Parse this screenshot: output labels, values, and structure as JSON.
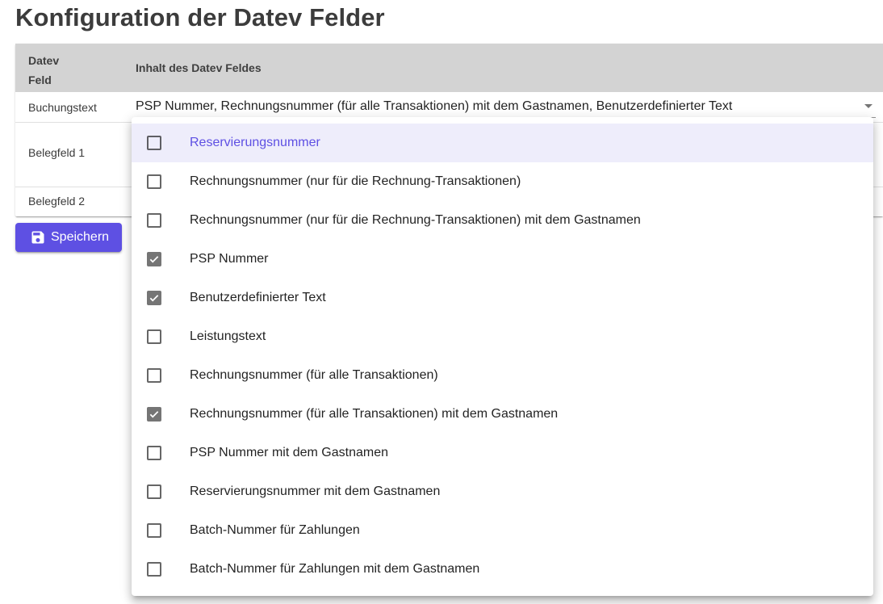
{
  "page": {
    "title": "Konfiguration der Datev Felder"
  },
  "table": {
    "header": {
      "feld": "Datev Feld",
      "inhalt": "Inhalt des Datev Feldes"
    },
    "rows": [
      {
        "feld": "Buchungstext",
        "inhalt": "PSP Nummer, Rechnungsnummer (für alle Transaktionen) mit dem Gastnamen, Benutzerdefinierter Text"
      },
      {
        "feld": "Belegfeld 1",
        "inhalt": ""
      },
      {
        "feld": "Belegfeld 2",
        "inhalt": ""
      }
    ]
  },
  "save_button": {
    "label": "Speichern",
    "icon": "save-icon"
  },
  "menu": {
    "items": [
      {
        "label": "Reservierungsnummer",
        "checked": false,
        "active": true
      },
      {
        "label": "Rechnungsnummer (nur für die Rechnung-Transaktionen)",
        "checked": false
      },
      {
        "label": "Rechnungsnummer (nur für die Rechnung-Transaktionen) mit dem Gastnamen",
        "checked": false
      },
      {
        "label": "PSP Nummer",
        "checked": true
      },
      {
        "label": "Benutzerdefinierter Text",
        "checked": true
      },
      {
        "label": "Leistungstext",
        "checked": false
      },
      {
        "label": "Rechnungsnummer (für alle Transaktionen)",
        "checked": false
      },
      {
        "label": "Rechnungsnummer (für alle Transaktionen) mit dem Gastnamen",
        "checked": true
      },
      {
        "label": "PSP Nummer mit dem Gastnamen",
        "checked": false
      },
      {
        "label": "Reservierungsnummer mit dem Gastnamen",
        "checked": false
      },
      {
        "label": "Batch-Nummer für Zahlungen",
        "checked": false
      },
      {
        "label": "Batch-Nummer für Zahlungen mit dem Gastnamen",
        "checked": false
      }
    ]
  },
  "colors": {
    "primary": "#5e50e3",
    "header_bg": "#d3d3d3",
    "checkbox_checked": "#757575"
  }
}
